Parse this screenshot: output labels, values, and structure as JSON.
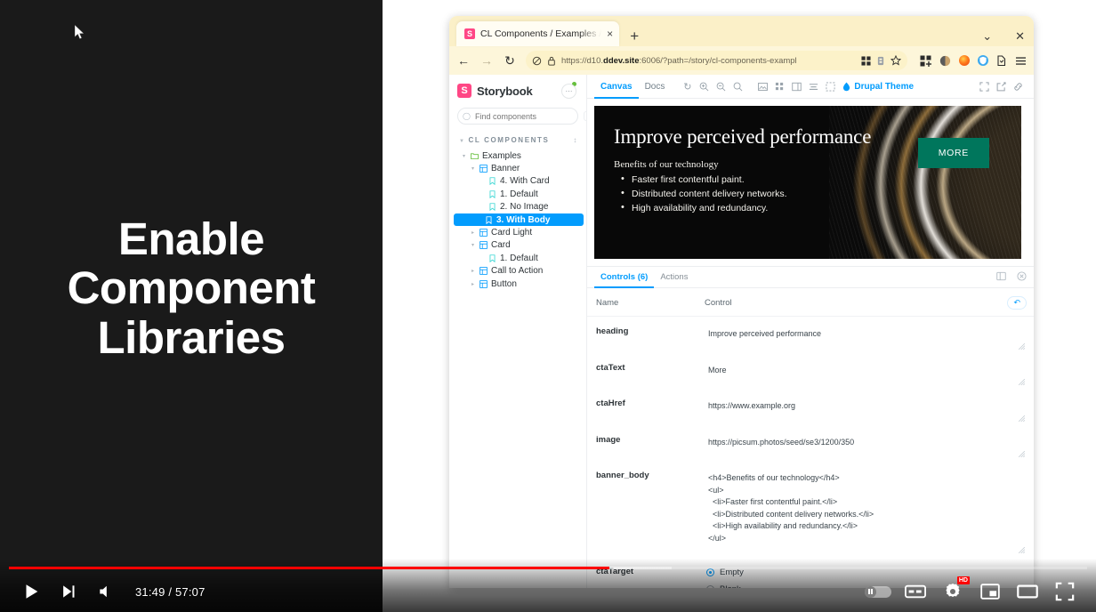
{
  "video": {
    "slide_title": "Enable Component Libraries",
    "current_time": "31:49",
    "total_time": "57:07",
    "time_display": "31:49 / 57:07",
    "progress_percent": 55.7,
    "buffered_percent": 61.5,
    "quality_badge": "HD",
    "controls": {
      "play": "play-button",
      "next": "next-video-button",
      "volume": "volume-button",
      "autoplay": "autoplay-toggle",
      "subtitles": "CC",
      "settings": "settings-gear",
      "miniplayer": "miniplayer-button",
      "theater": "theater-mode-button",
      "fullscreen": "fullscreen-button"
    }
  },
  "browser": {
    "tab": {
      "title": "CL Components / Examples /",
      "favicon_letter": "S",
      "close": "×"
    },
    "new_tab": "+",
    "window_controls": {
      "list_all_tabs": "⌄",
      "close": "✕"
    },
    "nav": {
      "back": "←",
      "forward": "→",
      "reload": "↻"
    },
    "url": {
      "prefix": "https://d10.",
      "domain": "ddev.site",
      "suffix": ":6006/?path=/story/cl-components-exampl",
      "full": "https://d10.ddev.site:6006/?path=/story/cl-components-exampl"
    },
    "url_icons": [
      "no-tracking-icon",
      "lock-icon",
      "extensions-icon",
      "container-icon",
      "bookmark-star-icon"
    ],
    "toolbar_icons": [
      "extensions-grid-icon",
      "container-tabs-icon",
      "firefox-account-icon",
      "shield-icon",
      "pocket-icon",
      "app-menu-icon"
    ]
  },
  "storybook": {
    "brand": "Storybook",
    "brand_letter": "S",
    "menu_button": "⋯",
    "search": {
      "placeholder": "Find components",
      "shortcut": "/"
    },
    "section_title": "CL COMPONENTS",
    "tree": [
      {
        "label": "Examples",
        "depth": 0,
        "type": "folder",
        "expanded": true,
        "selected": false
      },
      {
        "label": "Banner",
        "depth": 1,
        "type": "component",
        "expanded": true,
        "selected": false
      },
      {
        "label": "4. With Card",
        "depth": 2,
        "type": "story",
        "selected": false
      },
      {
        "label": "1. Default",
        "depth": 2,
        "type": "story",
        "selected": false
      },
      {
        "label": "2. No Image",
        "depth": 2,
        "type": "story",
        "selected": false
      },
      {
        "label": "3. With Body",
        "depth": 2,
        "type": "story",
        "selected": true
      },
      {
        "label": "Card Light",
        "depth": 1,
        "type": "component",
        "expanded": false,
        "selected": false
      },
      {
        "label": "Card",
        "depth": 1,
        "type": "component",
        "expanded": true,
        "selected": false
      },
      {
        "label": "1. Default",
        "depth": 2,
        "type": "story",
        "selected": false
      },
      {
        "label": "Call to Action",
        "depth": 1,
        "type": "component",
        "expanded": false,
        "selected": false
      },
      {
        "label": "Button",
        "depth": 1,
        "type": "component",
        "expanded": false,
        "selected": false
      }
    ],
    "toolbar": {
      "tabs": [
        {
          "label": "Canvas",
          "active": true
        },
        {
          "label": "Docs",
          "active": false
        }
      ],
      "icons": [
        "remount-icon",
        "zoom-in-icon",
        "zoom-out-icon",
        "zoom-reset-icon",
        "background-icon",
        "grid-icon",
        "measure-icon",
        "viewport-icon",
        "outline-icon"
      ],
      "theme_label": "Drupal Theme",
      "right_icons": [
        "fullscreen-icon",
        "open-new-tab-icon",
        "copy-link-icon"
      ]
    }
  },
  "preview": {
    "heading": "Improve perceived performance",
    "subheading": "Benefits of our technology",
    "bullets": [
      "Faster first contentful paint.",
      "Distributed content delivery networks.",
      "High availability and redundancy."
    ],
    "cta_label": "MORE",
    "cta_color": "#00765c"
  },
  "addons": {
    "tabs": [
      {
        "label": "Controls (6)",
        "active": true
      },
      {
        "label": "Actions",
        "active": false
      }
    ],
    "right_icons": [
      "panel-position-icon",
      "close-panel-icon"
    ],
    "columns": {
      "name": "Name",
      "control": "Control"
    },
    "reset_label": "↶",
    "controls": [
      {
        "name": "heading",
        "type": "text",
        "value": "Improve perceived performance"
      },
      {
        "name": "ctaText",
        "type": "text",
        "value": "More"
      },
      {
        "name": "ctaHref",
        "type": "text",
        "value": "https://www.example.org"
      },
      {
        "name": "image",
        "type": "text",
        "value": "https://picsum.photos/seed/se3/1200/350"
      },
      {
        "name": "banner_body",
        "type": "textarea",
        "value": "<h4>Benefits of our technology</h4>\n<ul>\n  <li>Faster first contentful paint.</li>\n  <li>Distributed content delivery networks.</li>\n  <li>High availability and redundancy.</li>\n</ul>"
      },
      {
        "name": "ctaTarget",
        "type": "radio",
        "options": [
          {
            "label": "Empty",
            "selected": true
          },
          {
            "label": "Blank",
            "selected": false
          }
        ]
      }
    ]
  },
  "colors": {
    "accent_blue": "#029cfd",
    "storybook_pink": "#ff4785",
    "youtube_red": "#ff0000",
    "cta_green": "#00765c",
    "browser_chrome": "#fdf6da"
  }
}
